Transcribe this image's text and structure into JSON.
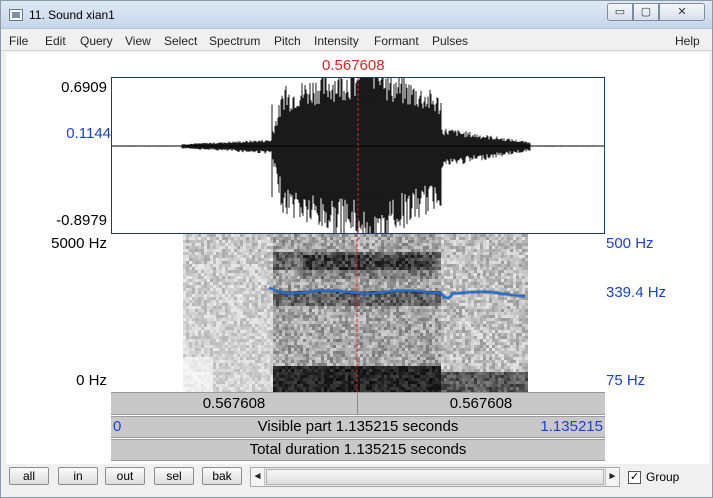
{
  "window": {
    "title": "11. Sound xian1"
  },
  "window_controls": {
    "minimize": "▭",
    "maximize": "▢",
    "close": "✕"
  },
  "menu": {
    "items": [
      "File",
      "Edit",
      "Query",
      "View",
      "Select",
      "Spectrum",
      "Pitch",
      "Intensity",
      "Formant",
      "Pulses"
    ],
    "help": "Help"
  },
  "cursor": {
    "label": "0.567608",
    "time": 0.567608
  },
  "waveform": {
    "max_label": "0.6909",
    "cursor_value_label": "0.1144",
    "min_label": "-0.8979",
    "max": 0.6909,
    "min": -0.8979
  },
  "spectrogram": {
    "top_label": "5000 Hz",
    "bottom_label": "0 Hz",
    "pitch_top_label": "500 Hz",
    "pitch_value_label": "339.4 Hz",
    "pitch_bottom_label": "75 Hz"
  },
  "selection": {
    "left_label": "0.567608",
    "right_label": "0.567608"
  },
  "visible": {
    "start_label": "0",
    "text": "Visible part 1.135215 seconds",
    "end_label": "1.135215"
  },
  "total": {
    "text": "Total duration 1.135215 seconds"
  },
  "toolbar": {
    "buttons": [
      "all",
      "in",
      "out",
      "sel",
      "bak"
    ],
    "scroll_left": "◄",
    "scroll_right": "►",
    "group_label": "Group",
    "group_checked": true,
    "group_check_mark": "✓"
  },
  "colors": {
    "cursor": "#dd2222",
    "pitch_line": "#1a6fe0",
    "axis_blue": "#1a3fd6"
  }
}
